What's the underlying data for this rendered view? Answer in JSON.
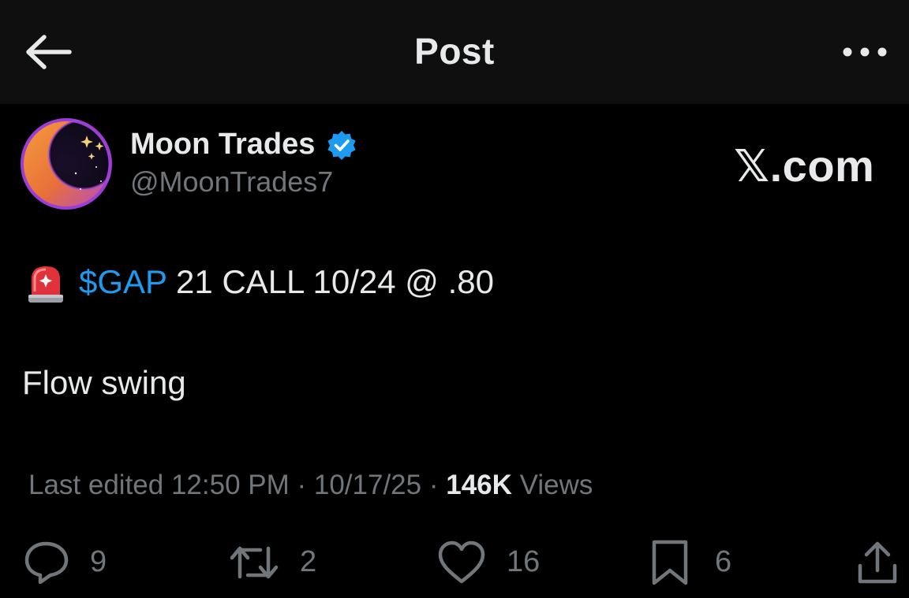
{
  "header": {
    "title": "Post",
    "back_icon": "arrow-left-icon",
    "more_icon": "more-horizontal-icon"
  },
  "author": {
    "display_name": "Moon Trades",
    "handle": "@MoonTrades7",
    "verified": true,
    "verified_color": "#1d9bf0"
  },
  "watermark": "𝕏.com",
  "post": {
    "emoji_icon": "rotating-light-icon",
    "cashtag": "$GAP",
    "line1_rest": " 21 CALL 10/24 @ .80",
    "line2": "Flow swing"
  },
  "meta": {
    "edited_label": "Last edited 12:50 PM · 10/17/25 · ",
    "views_count": "146K",
    "views_label": " Views"
  },
  "actions": {
    "replies": "9",
    "reposts": "2",
    "likes": "16",
    "bookmarks": "6"
  },
  "colors": {
    "background": "#000000",
    "header_bg": "#0f0f0f",
    "text": "#e7e9ea",
    "muted": "#71767b",
    "accent": "#1d9bf0"
  }
}
